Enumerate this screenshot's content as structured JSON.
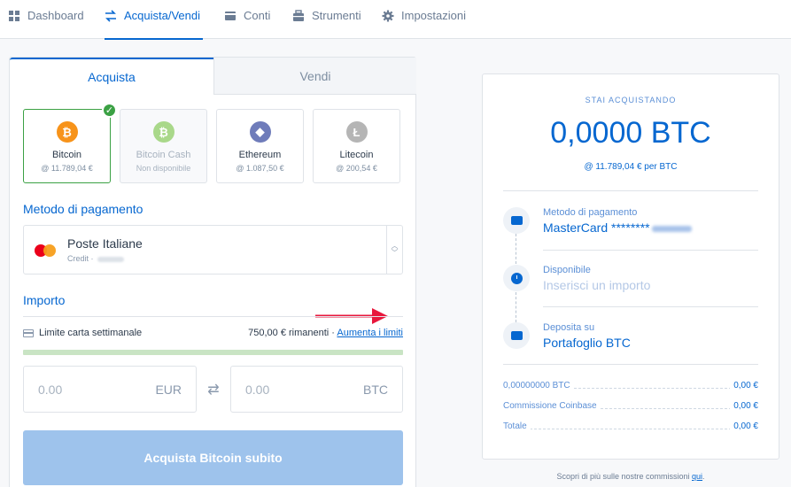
{
  "nav": {
    "items": [
      {
        "label": "Dashboard",
        "icon": "grid-icon"
      },
      {
        "label": "Acquista/Vendi",
        "icon": "swap-icon",
        "active": true
      },
      {
        "label": "Conti",
        "icon": "wallet-icon"
      },
      {
        "label": "Strumenti",
        "icon": "toolbox-icon"
      },
      {
        "label": "Impostazioni",
        "icon": "gear-icon"
      }
    ]
  },
  "tabs": {
    "buy": "Acquista",
    "sell": "Vendi"
  },
  "coins": [
    {
      "name": "Bitcoin",
      "price": "@ 11.789,04 €",
      "symbol": "₿",
      "color": "#f7931a",
      "selected": true
    },
    {
      "name": "Bitcoin Cash",
      "price": "Non disponibile",
      "symbol": "₿",
      "color": "#8dc351",
      "disabled": true
    },
    {
      "name": "Ethereum",
      "price": "@ 1.087,50 €",
      "symbol": "◆",
      "color": "#6f7cba"
    },
    {
      "name": "Litecoin",
      "price": "@ 200,54 €",
      "symbol": "Ł",
      "color": "#b5b5b5"
    }
  ],
  "payment": {
    "section_label": "Metodo di pagamento",
    "name": "Poste Italiane",
    "sub": "Credit ·"
  },
  "amount": {
    "section_label": "Importo",
    "limit_label": "Limite carta settimanale",
    "limit_remaining": "750,00 € rimanenti ·",
    "limit_link": "Aumenta i limiti",
    "limit_progress": 1.0,
    "eur_value": "0.00",
    "eur_currency": "EUR",
    "btc_value": "0.00",
    "btc_currency": "BTC"
  },
  "buy_button": "Acquista Bitcoin subito",
  "summary": {
    "heading": "STAI ACQUISTANDO",
    "amount": "0,0000 BTC",
    "rate": "@ 11.789,04 € per BTC",
    "steps": [
      {
        "label": "Metodo di pagamento",
        "value": "MasterCard ********"
      },
      {
        "label": "Disponibile",
        "value": "Inserisci un importo"
      },
      {
        "label": "Deposita su",
        "value": "Portafoglio BTC"
      }
    ],
    "rows": [
      {
        "label": "0,00000000 BTC",
        "value": "0,00 €"
      },
      {
        "label": "Commissione Coinbase",
        "value": "0,00 €"
      },
      {
        "label": "Totale",
        "value": "0,00 €"
      }
    ]
  },
  "footer": {
    "text": "Scopri di più sulle nostre commissioni",
    "link": "qui",
    "suffix": "."
  },
  "colors": {
    "accent": "#0667d0",
    "success": "#3ba144",
    "annotation_arrow": "#e8173c"
  }
}
